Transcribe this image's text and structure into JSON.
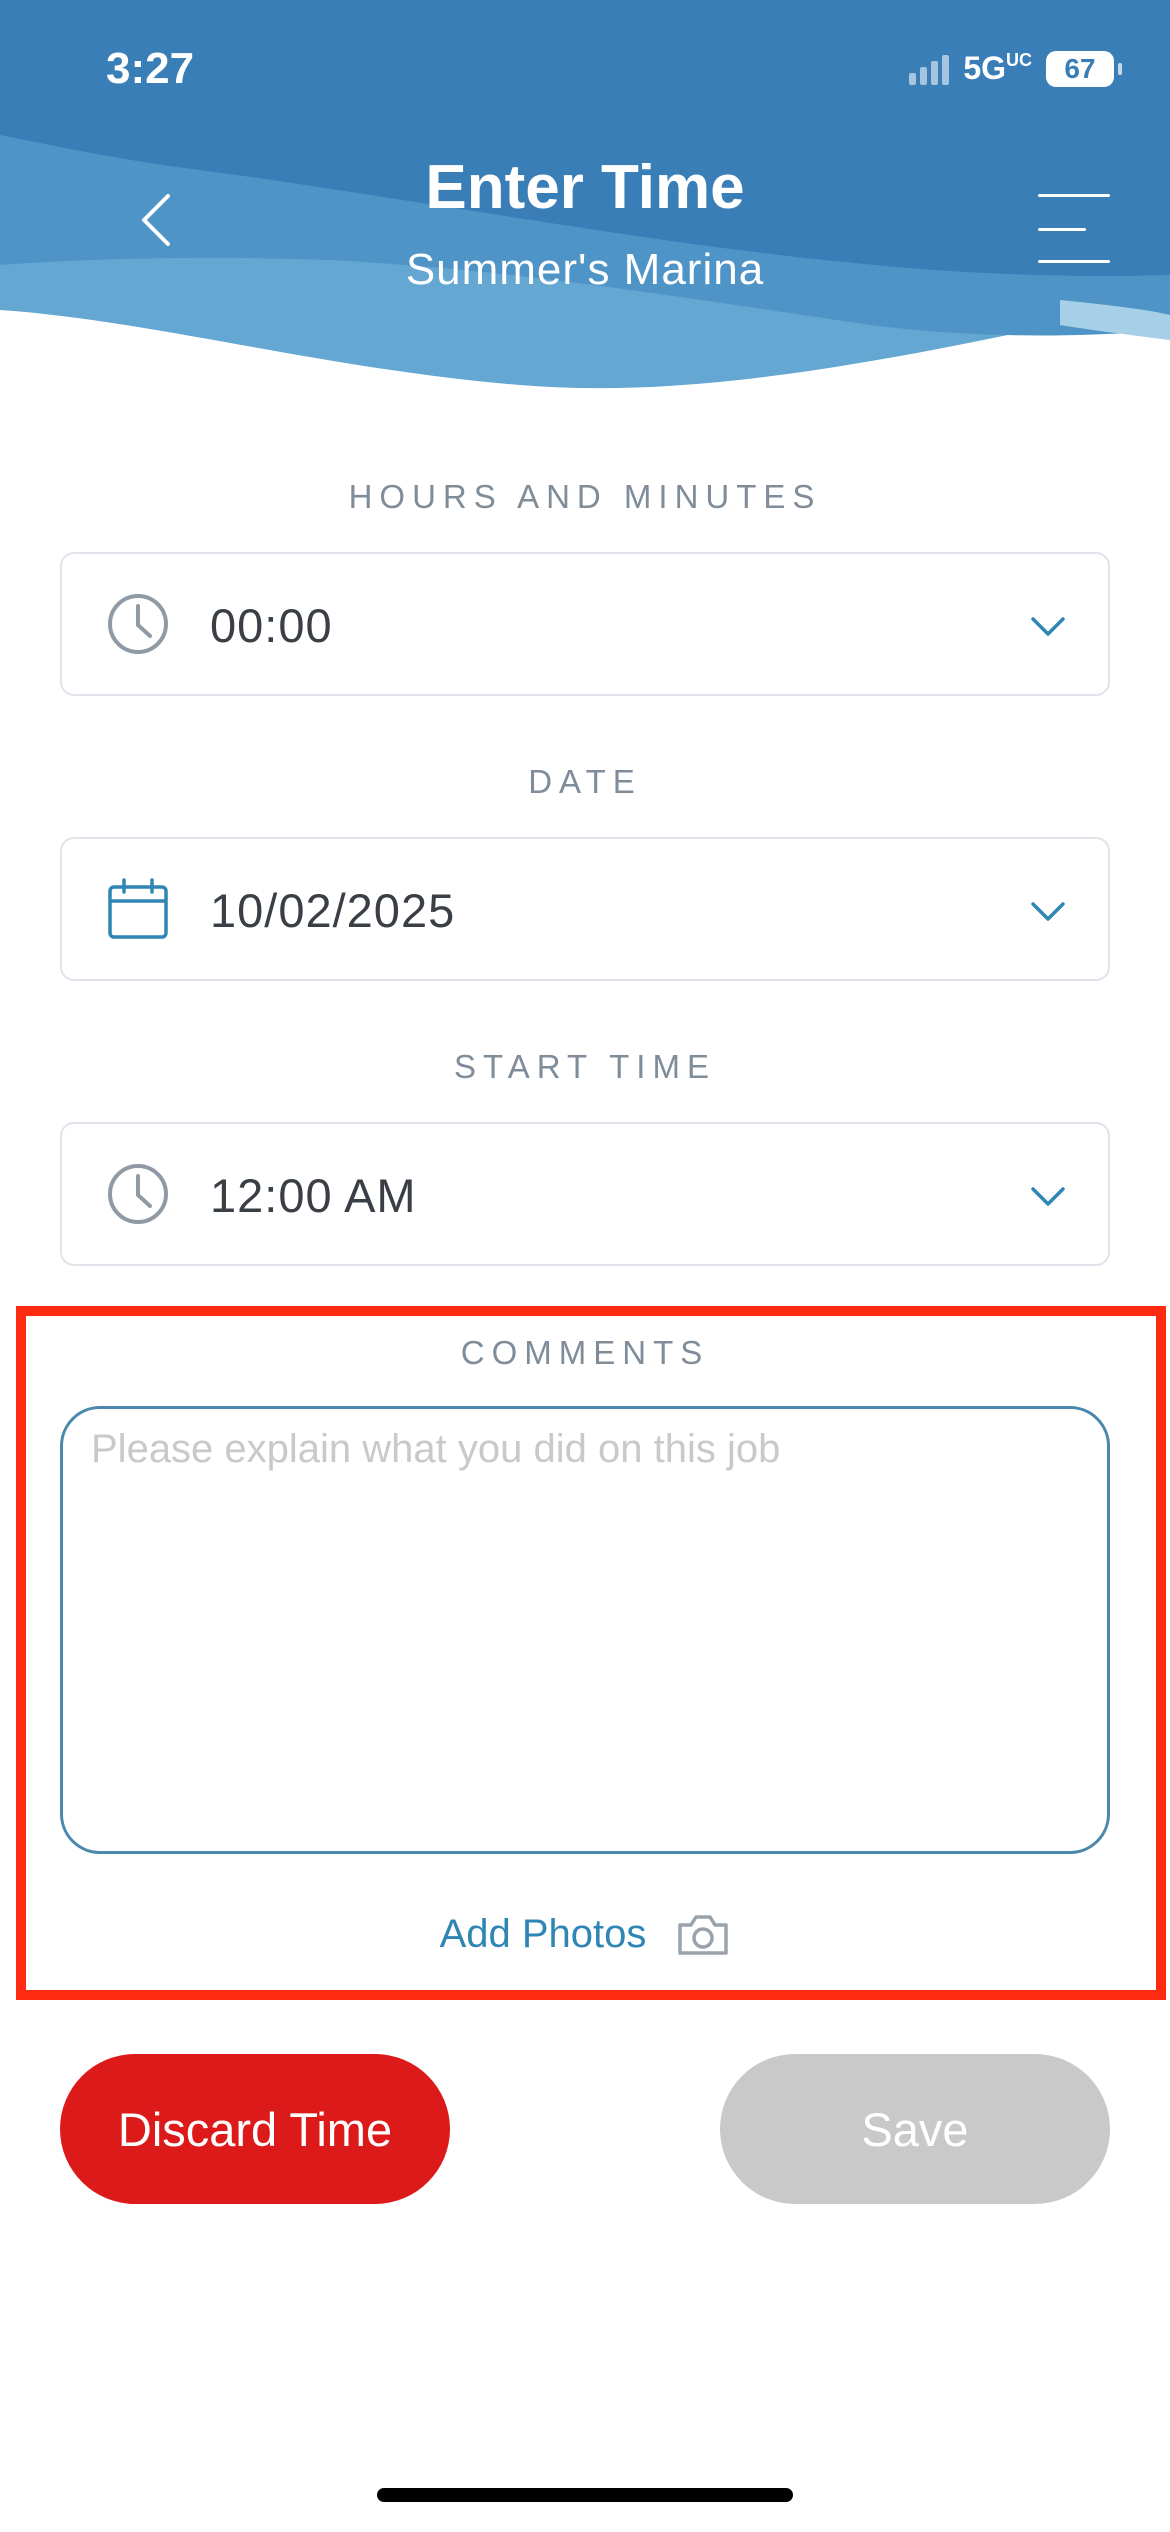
{
  "status_bar": {
    "time": "3:27",
    "network": "5G",
    "network_suffix": "UC",
    "battery": "67"
  },
  "header": {
    "title": "Enter Time",
    "subtitle": "Summer's Marina",
    "back_icon": "chevron-left-icon",
    "menu_icon": "hamburger-menu-icon"
  },
  "fields": {
    "hours": {
      "label": "HOURS AND MINUTES",
      "value": "00:00",
      "icon": "clock-icon"
    },
    "date": {
      "label": "DATE",
      "value": "10/02/2025",
      "icon": "calendar-icon"
    },
    "start_time": {
      "label": "START TIME",
      "value": "12:00 AM",
      "icon": "clock-icon"
    }
  },
  "comments": {
    "label": "COMMENTS",
    "placeholder": "Please explain what you did on this job",
    "value": ""
  },
  "add_photos": {
    "label": "Add Photos",
    "icon": "camera-icon"
  },
  "buttons": {
    "discard": "Discard Time",
    "save": "Save"
  },
  "colors": {
    "header_blue": "#3a7eb7",
    "accent_blue": "#2f86b4",
    "discard_red": "#dd1a1a",
    "disabled_gray": "#c9c9c9",
    "highlight_red": "#ff2a12"
  }
}
